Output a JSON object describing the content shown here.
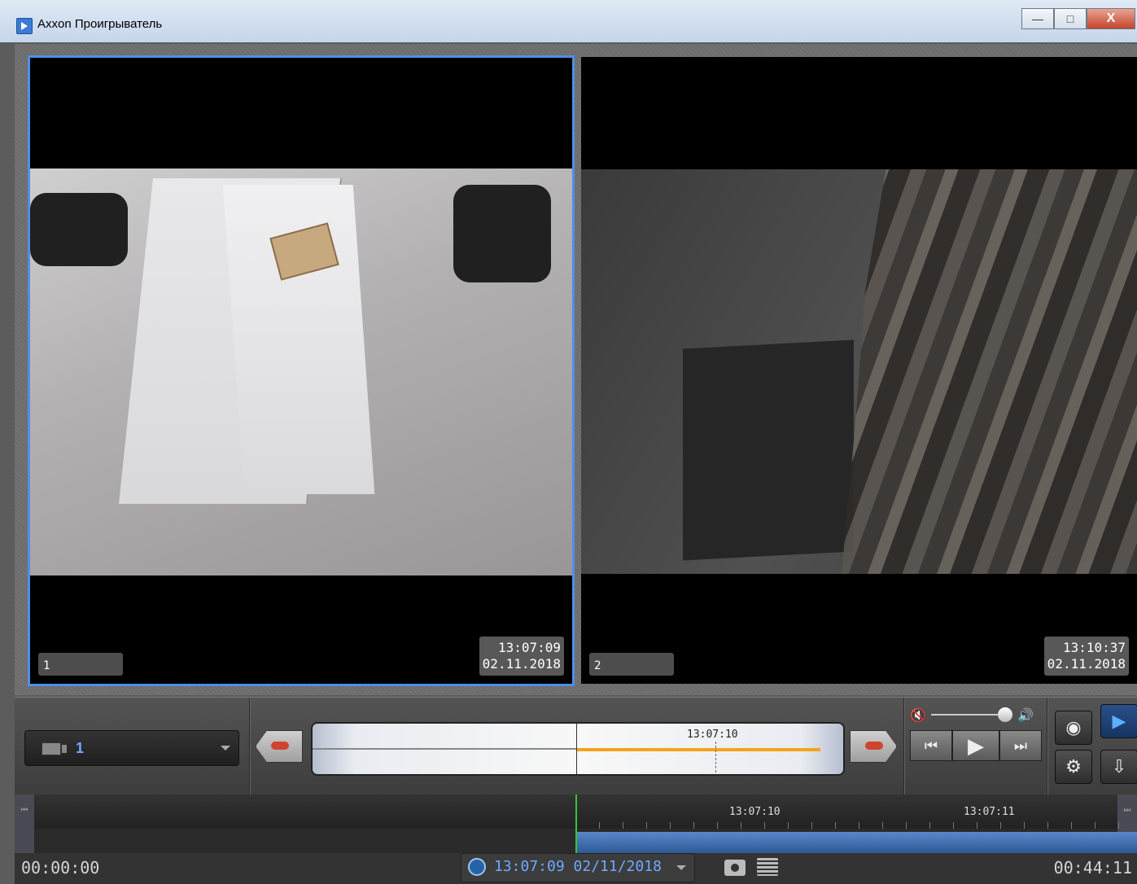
{
  "window": {
    "title": "Axxon Проигрыватель",
    "min_glyph": "—",
    "max_glyph": "□",
    "close_glyph": "X"
  },
  "cameras": [
    {
      "label": "1",
      "time": "13:07:09",
      "date": "02.11.2018"
    },
    {
      "label": "2",
      "time": "13:10:37",
      "date": "02.11.2018"
    }
  ],
  "controls": {
    "camera_select": "1",
    "mini_timeline_time": "13:07:10",
    "mute_glyph": "🔇",
    "speaker_glyph": "🔊",
    "prev_glyph": "⏮",
    "play_glyph": "▶",
    "next_glyph": "⏭",
    "eye_glyph": "◉",
    "gear_glyph": "⚙",
    "play_mode_glyph": "▶",
    "export_glyph": "⇩",
    "accent_color": "#4f8fe8",
    "progress_color": "#f4a31a"
  },
  "timeline": {
    "labels": [
      "13:07:10",
      "13:07:11"
    ],
    "start_marker": "⏮",
    "end_marker": "⏭"
  },
  "status": {
    "elapsed": "00:00:00",
    "current_datetime": "13:07:09 02/11/2018",
    "total": "00:44:11"
  }
}
